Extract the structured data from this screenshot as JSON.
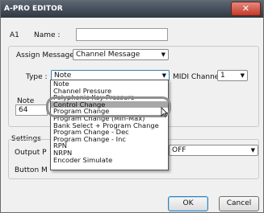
{
  "window": {
    "title": "A-PRO EDITOR",
    "close_glyph": "✕"
  },
  "item": {
    "id": "A1",
    "name_label": "Name :",
    "name_value": ""
  },
  "assign_message": {
    "label": "Assign Message :",
    "value": "Channel Message"
  },
  "type": {
    "label": "Type :",
    "value": "Note",
    "options": [
      "Note",
      "Channel Pressure",
      "Polyphonic Key Pressure",
      "Control Change",
      "Program Change",
      "Program Change (Min-Max)",
      "Bank Select + Program Change",
      "Program Change - Dec",
      "Program Change - Inc",
      "RPN",
      "NRPN",
      "Encoder Simulate"
    ],
    "highlighted_index": 3
  },
  "midi_channel": {
    "label": "MIDI Channel :",
    "value": "1"
  },
  "note": {
    "label": "Note",
    "value": "64"
  },
  "settings": {
    "label": "Settings",
    "output_label": "Output P",
    "button_label": "Button M",
    "output_value": "OFF"
  },
  "buttons": {
    "ok": "OK",
    "cancel": "Cancel"
  },
  "icons": {
    "arrow": "chevron-down-icon",
    "cursor": "mouse-pointer-icon"
  }
}
